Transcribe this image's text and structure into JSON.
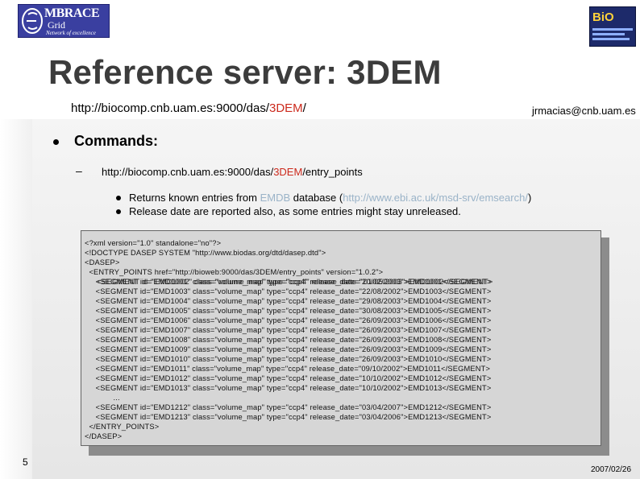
{
  "logos": {
    "left_brand": "MBRACE",
    "left_brand2": "Grid",
    "left_sub": "Network of excellence",
    "right_brand": "BiO"
  },
  "slide": {
    "title": "Reference server: 3DEM",
    "url_prefix": "http://biocomp.cnb.uam.es:9000/das/",
    "url_highlight": "3DEM",
    "url_suffix": "/",
    "email": "jrmacias@cnb.uam.es",
    "commands_heading": "Commands:",
    "sub_url_prefix": "http://biocomp.cnb.uam.es:9000/das/",
    "sub_url_highlight": "3DEM",
    "sub_url_suffix": "/entry_points",
    "bullet1_pre": "Returns known entries from ",
    "bullet1_faint": "EMDB",
    "bullet1_mid": " database (",
    "bullet1_link": "http://www.ebi.ac.uk/msd-srv/emsearch/",
    "bullet1_post": ")",
    "bullet2": "Release date are reported also, as some entries might stay unreleased.",
    "page_number": "5",
    "date": "2007/02/26"
  },
  "xml_lines": [
    "<?xml version=\"1.0\" standalone=\"no\"?>",
    "<!DOCTYPE DASEP SYSTEM \"http://www.biodas.org/dtd/dasep.dtd\">",
    "<DASEP>",
    "  <ENTRY_POINTS href=\"http://bioweb:9000/das/3DEM/entry_points\" version=\"1.0.2\">",
    "     <SEGMENT id=\"EMD1001\" class=\"volume_map\" type=\"ccp4\" release_date=\"20/02/2003\">EMD1001</SEGMENT>",
    "     <SEGMENT id=\"EMD1003\" class=\"volume_map\" type=\"ccp4\" release_date=\"22/08/2002\">EMD1003</SEGMENT>",
    "     <SEGMENT id=\"EMD1004\" class=\"volume_map\" type=\"ccp4\" release_date=\"29/08/2003\">EMD1004</SEGMENT>",
    "     <SEGMENT id=\"EMD1005\" class=\"volume_map\" type=\"ccp4\" release_date=\"30/08/2003\">EMD1005</SEGMENT>",
    "     <SEGMENT id=\"EMD1006\" class=\"volume_map\" type=\"ccp4\" release_date=\"26/09/2003\">EMD1006</SEGMENT>",
    "     <SEGMENT id=\"EMD1007\" class=\"volume_map\" type=\"ccp4\" release_date=\"26/09/2003\">EMD1007</SEGMENT>",
    "     <SEGMENT id=\"EMD1008\" class=\"volume_map\" type=\"ccp4\" release_date=\"26/09/2003\">EMD1008</SEGMENT>",
    "     <SEGMENT id=\"EMD1009\" class=\"volume_map\" type=\"ccp4\" release_date=\"26/09/2003\">EMD1009</SEGMENT>",
    "     <SEGMENT id=\"EMD1010\" class=\"volume_map\" type=\"ccp4\" release_date=\"26/09/2003\">EMD1010</SEGMENT>",
    "     <SEGMENT id=\"EMD1011\" class=\"volume_map\" type=\"ccp4\" release_date=\"09/10/2002\">EMD1011</SEGMENT>",
    "     <SEGMENT id=\"EMD1012\" class=\"volume_map\" type=\"ccp4\" release_date=\"10/10/2002\">EMD1012</SEGMENT>",
    "     <SEGMENT id=\"EMD1013\" class=\"volume_map\" type=\"ccp4\" release_date=\"10/10/2002\">EMD1013</SEGMENT>",
    "             ...",
    "     <SEGMENT id=\"EMD1212\" class=\"volume_map\" type=\"ccp4\" release_date=\"03/04/2007\">EMD1212</SEGMENT>",
    "     <SEGMENT id=\"EMD1213\" class=\"volume_map\" type=\"ccp4\" release_date=\"03/04/2006\">EMD1213</SEGMENT>",
    "  </ENTRY_POINTS>",
    "</DASEP>"
  ],
  "xml_overlap_line": "     <SEGMENT id=\"EMD1002\" class=\"volume_map\" type=\"ccp4\" release_date=\"01/05/2003\">EMD1002</SEGMENT>"
}
